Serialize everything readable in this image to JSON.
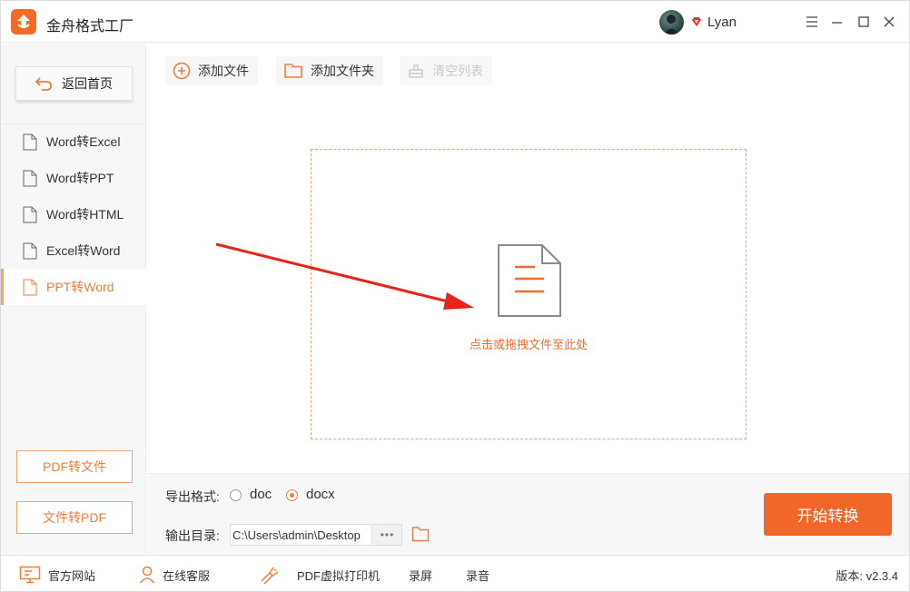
{
  "app": {
    "title": "金舟格式工厂",
    "username": "Lyan"
  },
  "colors": {
    "accent": "#f2662a",
    "accent_text": "#ee6d2d",
    "active_nav": "#f07e3c"
  },
  "sidebar": {
    "home_label": "返回首页",
    "items": [
      {
        "label": "Word转Excel",
        "icon_letter": "E"
      },
      {
        "label": "Word转PPT",
        "icon_letter": "P"
      },
      {
        "label": "Word转HTML",
        "icon_letter": "H"
      },
      {
        "label": "Excel转Word",
        "icon_letter": "W"
      },
      {
        "label": "PPT转Word",
        "icon_letter": "W",
        "active": true
      }
    ],
    "pdf_to_file": "PDF转文件",
    "file_to_pdf": "文件转PDF"
  },
  "toolbar": {
    "add_file": "添加文件",
    "add_folder": "添加文件夹",
    "clear_list": "清空列表"
  },
  "dropzone": {
    "text": "点击或拖拽文件至此处"
  },
  "options": {
    "format_label": "导出格式:",
    "formats": [
      {
        "label": "doc",
        "checked": false
      },
      {
        "label": "docx",
        "checked": true
      }
    ],
    "output_label": "输出目录:",
    "output_path": "C:\\Users\\admin\\Desktop",
    "more": "•••"
  },
  "start_label": "开始转换",
  "statusbar": {
    "website": "官方网站",
    "support": "在线客服",
    "printer": "PDF虚拟打印机",
    "screen_record": "录屏",
    "audio_record": "录音",
    "version": "版本: v2.3.4"
  }
}
